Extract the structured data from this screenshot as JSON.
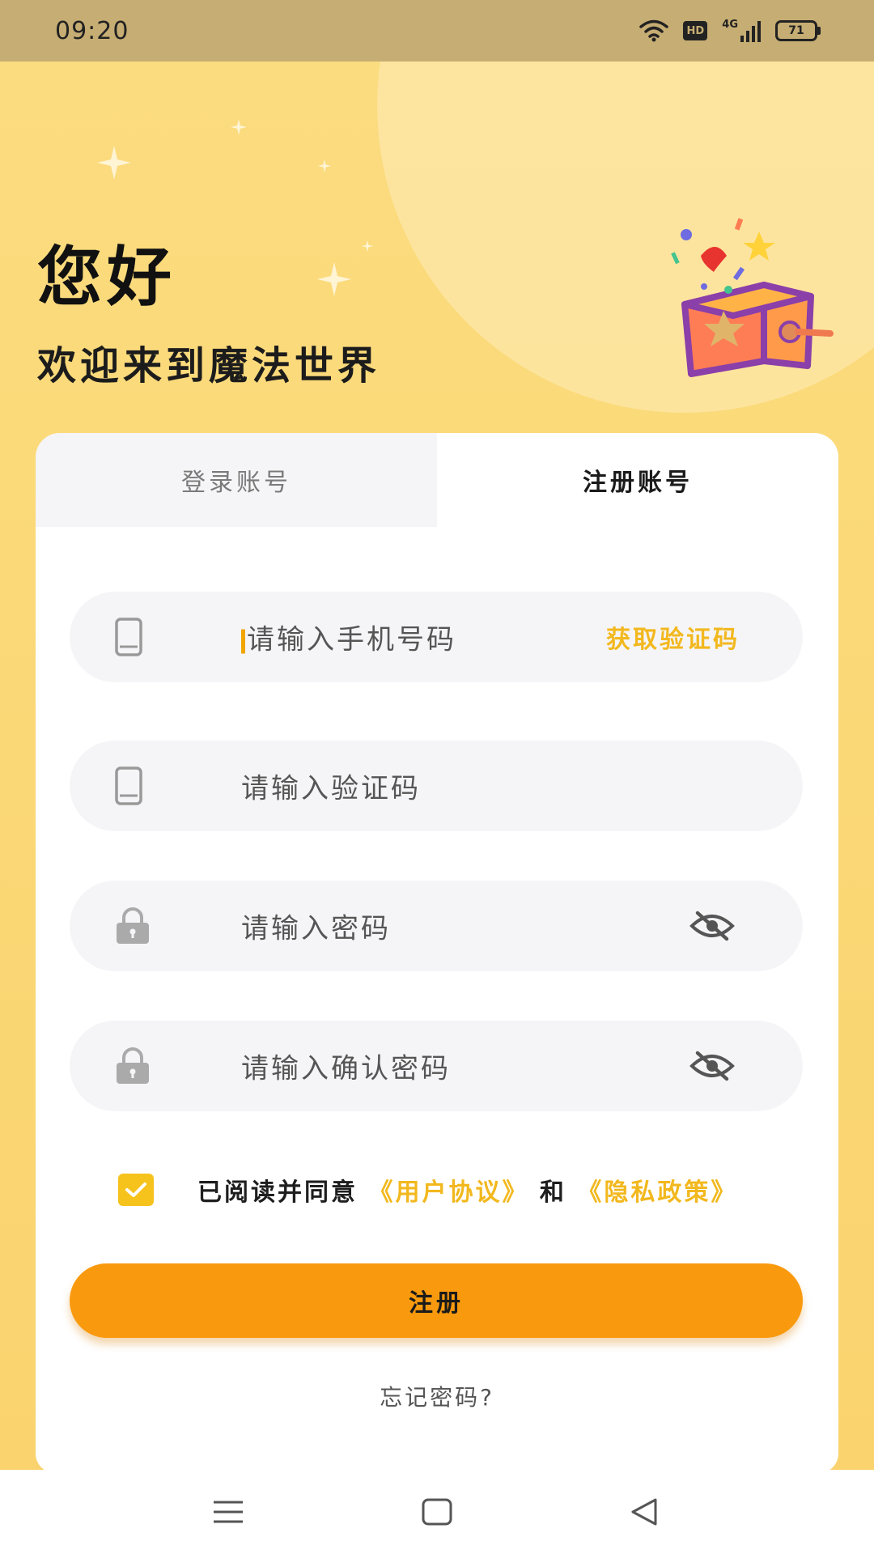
{
  "status_bar": {
    "time": "09:20",
    "hd_label": "HD",
    "network_label": "4G",
    "battery_level": "71",
    "icons": [
      "wifi-icon",
      "hd-icon",
      "signal-icon",
      "battery-icon"
    ]
  },
  "header": {
    "greeting": "您好",
    "subtitle": "欢迎来到魔法世界"
  },
  "tabs": [
    {
      "label": "登录账号",
      "active": false
    },
    {
      "label": "注册账号",
      "active": true
    }
  ],
  "form": {
    "phone": {
      "placeholder": "请输入手机号码",
      "icon": "phone-icon",
      "action_label": "获取验证码"
    },
    "code": {
      "placeholder": "请输入验证码",
      "icon": "phone-icon"
    },
    "password": {
      "placeholder": "请输入密码",
      "icon": "lock-icon",
      "toggle_icon": "eye-off-icon"
    },
    "confirm_password": {
      "placeholder": "请输入确认密码",
      "icon": "lock-icon",
      "toggle_icon": "eye-off-icon"
    }
  },
  "agreement": {
    "checked": true,
    "prefix": "已阅读并同意",
    "user_agreement": "《用户协议》",
    "conjunction": "和",
    "privacy_policy": "《隐私政策》"
  },
  "submit_label": "注册",
  "forgot_label": "忘记密码?",
  "nav": [
    "menu-icon",
    "home-icon",
    "back-icon"
  ],
  "colors": {
    "background": "#fbd978",
    "accent": "#f99a0e",
    "link": "#f2b81e",
    "checkbox": "#f6c21c"
  }
}
